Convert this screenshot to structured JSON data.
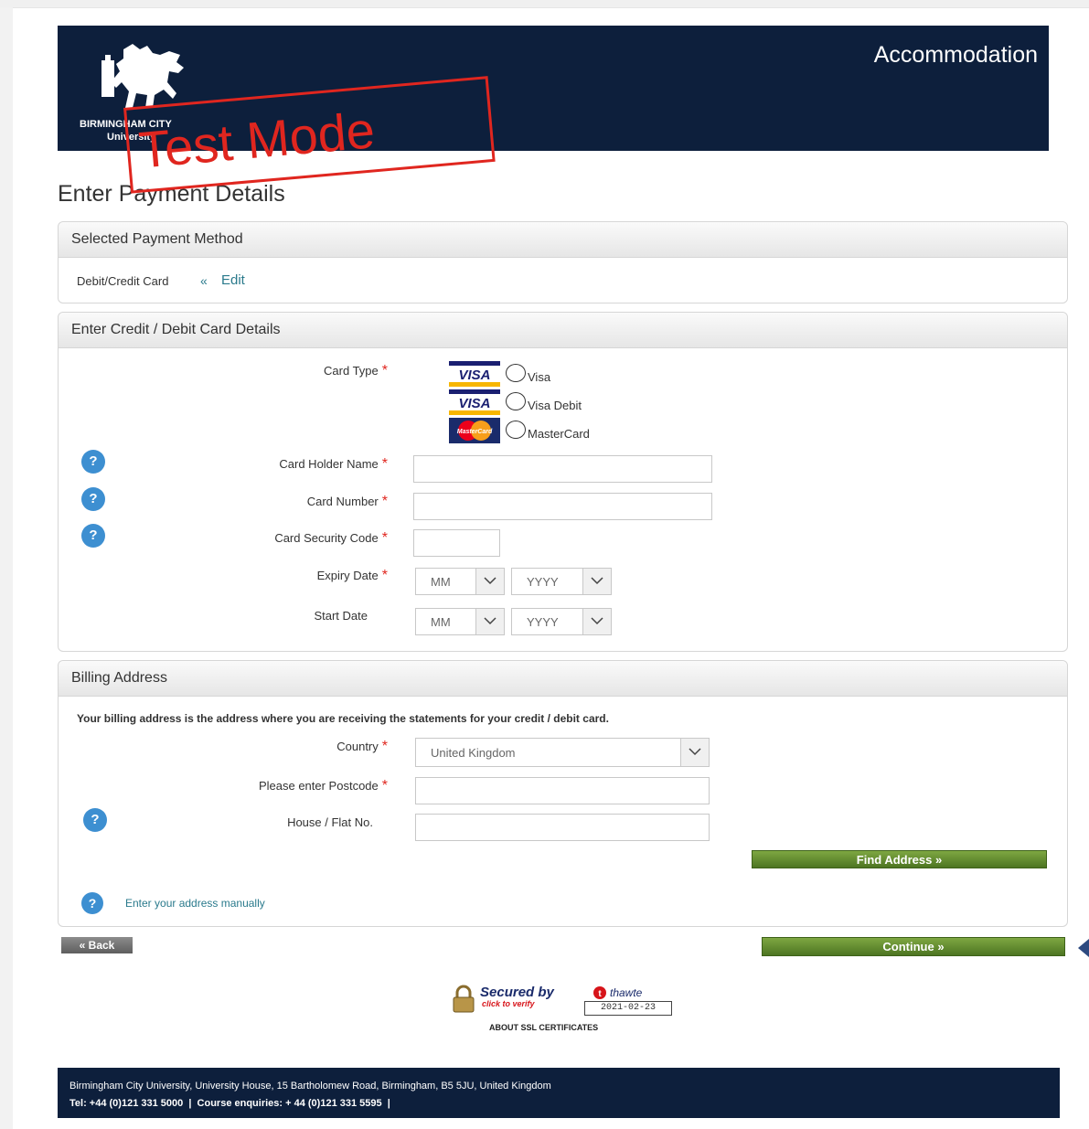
{
  "header": {
    "section_title": "Accommodation",
    "university_line1": "BIRMINGHAM CITY",
    "university_line2": "University"
  },
  "stamp_text": "Test Mode",
  "page_title": "Enter Payment Details",
  "selected_method_panel": {
    "heading": "Selected Payment Method",
    "method": "Debit/Credit Card",
    "edit_prefix": "«",
    "edit_label": "Edit"
  },
  "card_panel": {
    "heading": "Enter Credit / Debit Card Details",
    "card_type_label": "Card Type",
    "card_types": [
      {
        "logo": "VISA",
        "label": "Visa"
      },
      {
        "logo": "VISA",
        "label": "Visa Debit"
      },
      {
        "logo": "MasterCard",
        "label": "MasterCard"
      }
    ],
    "holder_label": "Card Holder Name",
    "number_label": "Card Number",
    "security_label": "Card Security Code",
    "expiry_label": "Expiry Date",
    "start_label": "Start Date",
    "month_placeholder": "MM",
    "year_placeholder": "YYYY",
    "required_mark": "*",
    "help_mark": "?"
  },
  "billing_panel": {
    "heading": "Billing Address",
    "intro": "Your billing address is the address where you are receiving the statements for your credit / debit card.",
    "country_label": "Country",
    "country_value": "United Kingdom",
    "postcode_label": "Please enter Postcode",
    "house_label": "House / Flat No.",
    "find_button": "Find Address »",
    "manual_link": "Enter your address manually"
  },
  "nav": {
    "back_button": "« Back",
    "continue_button": "Continue »"
  },
  "ssl": {
    "secured_by": "Secured by",
    "brand": "thawte",
    "click_verify": "click to verify",
    "date": "2021-02-23",
    "about_link": "ABOUT SSL CERTIFICATES"
  },
  "footer": {
    "address": "Birmingham City University, University House, 15 Bartholomew Road, Birmingham, B5 5JU, United Kingdom",
    "contacts": "Tel: +44 (0)121 331 5000  |  Course enquiries: + 44 (0)121 331 5595  |"
  },
  "colors": {
    "header_bg": "#0d1f3c",
    "stamp": "#e0261f",
    "button_green": "#5e8a2c",
    "help_blue": "#3d8fd1"
  }
}
